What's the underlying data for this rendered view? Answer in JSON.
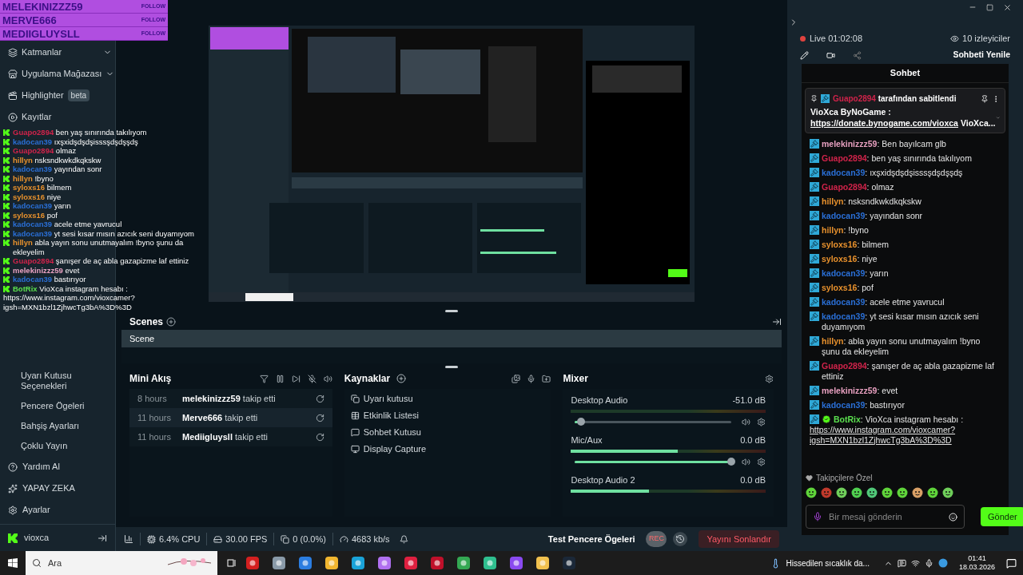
{
  "follow_alerts": [
    {
      "name": "MELEKINIZZZ59",
      "action": "FOLLOW"
    },
    {
      "name": "MERVE666",
      "action": "FOLLOW"
    },
    {
      "name": "MEDIIGLUYSLL",
      "action": "FOLLOW"
    }
  ],
  "sidebar": {
    "items": [
      {
        "label": "Katmanlar",
        "expandable": true
      },
      {
        "label": "Uygulama Mağazası",
        "expandable": true
      },
      {
        "label": "Highlighter",
        "expandable": false,
        "badge": "beta"
      },
      {
        "label": "Kayıtlar",
        "expandable": false
      }
    ],
    "sub_items": [
      "Uyarı Kutusu Seçenekleri",
      "Pencere Ögeleri",
      "Bahşiş Ayarları",
      "Çoklu Yayın"
    ],
    "bottom_items": [
      "Yardım Al",
      "YAPAY ZEKA",
      "Ayarlar"
    ],
    "user": "vioxca"
  },
  "overlay_chat": [
    {
      "user": "Guapo2894",
      "color": "#d0234a",
      "text": "ben yaş sınırında takılıyom"
    },
    {
      "user": "kadocan39",
      "color": "#2a6fd6",
      "text": "ıxşxidşdşdşisssşdşdşşdş"
    },
    {
      "user": "Guapo2894",
      "color": "#d0234a",
      "text": "olmaz"
    },
    {
      "user": "hillyn",
      "color": "#e8912d",
      "text": "nsksndkwkdkqkskw"
    },
    {
      "user": "kadocan39",
      "color": "#2a6fd6",
      "text": "yayından sonr"
    },
    {
      "user": "hillyn",
      "color": "#e8912d",
      "text": "!byno"
    },
    {
      "user": "syloxs16",
      "color": "#e8912d",
      "text": "bilmem"
    },
    {
      "user": "syloxs16",
      "color": "#e8912d",
      "text": "niye"
    },
    {
      "user": "kadocan39",
      "color": "#2a6fd6",
      "text": "yarın"
    },
    {
      "user": "syloxs16",
      "color": "#e8912d",
      "text": "pof"
    },
    {
      "user": "kadocan39",
      "color": "#2a6fd6",
      "text": "acele etme yavrucul"
    },
    {
      "user": "kadocan39",
      "color": "#2a6fd6",
      "text": "yt sesi kısar mısın azıcık seni duyamıyom"
    },
    {
      "user": "hillyn",
      "color": "#e8912d",
      "text": "abla yayın sonu unutmayalım !byno şunu da ekleyelim"
    },
    {
      "user": "Guapo2894",
      "color": "#d0234a",
      "text": "şanışer de aç abla gazapizme laf ettiniz"
    },
    {
      "user": "melekinizzz59",
      "color": "#e8a0c0",
      "text": "evet"
    },
    {
      "user": "kadocan39",
      "color": "#2a6fd6",
      "text": "bastırıyor"
    },
    {
      "user": "BotRix",
      "color": "#5be04f",
      "text": "VioXca instagram hesabı :",
      "link_lines": [
        "https://www.instagram.com/vioxcamer?",
        "igsh=MXN1bzl1ZjhwcTg3bA%3D%3D"
      ]
    }
  ],
  "scenes": {
    "title": "Scenes",
    "items": [
      {
        "label": "Scene",
        "selected": true
      }
    ]
  },
  "mini_feed": {
    "title": "Mini Akış",
    "events": [
      {
        "time": "8 hours",
        "user": "melekinizzz59",
        "action": "takip etti"
      },
      {
        "time": "11 hours",
        "user": "Merve666",
        "action": "takip etti"
      },
      {
        "time": "11 hours",
        "user": "Mediigluysll",
        "action": "takip etti"
      }
    ]
  },
  "sources": {
    "title": "Kaynaklar",
    "items": [
      "Uyarı kutusu",
      "Etkinlik Listesi",
      "Sohbet Kutusu",
      "Display Capture"
    ]
  },
  "mixer": {
    "title": "Mixer",
    "channels": [
      {
        "name": "Desktop Audio",
        "reading": "-51.0 dB",
        "fader": {
          "level": 0.04
        }
      },
      {
        "name": "Mic/Aux",
        "reading": "0.0 dB",
        "meter": {
          "level": 0.55
        },
        "fader": {
          "level": 1
        }
      },
      {
        "name": "Desktop Audio 2",
        "reading": "0.0 dB",
        "meter": {
          "level": 0.4
        }
      }
    ]
  },
  "status_bar": {
    "stats": [
      "6.4% CPU",
      "30.00 FPS",
      "0 (0.0%)",
      "4683 kb/s"
    ],
    "test_label": "Test Pencere Ögeleri",
    "rec": "REC",
    "end_stream": "Yayını Sonlandır"
  },
  "stream_info": {
    "live": "Live 01:02:08",
    "viewers": "10 izleyiciler",
    "refresh": "Sohbeti Yenile"
  },
  "chat": {
    "title": "Sohbet",
    "separator": ":",
    "pinned": {
      "by": {
        "name": "Guapo2894",
        "color": "#d0234a"
      },
      "suffix": "tarafından sabitlendi",
      "title": "VioXca ByNoGame :",
      "link": "https://donate.bynogame.com/vioxca",
      "tail": "VioXca..."
    },
    "messages": [
      {
        "user": "melekinizzz59",
        "color": "#e8a0c0",
        "text": "Ben bayılcam glb",
        "verified": false
      },
      {
        "user": "Guapo2894",
        "color": "#d0234a",
        "text": "ben yaş sınırında takılıyom",
        "verified": false
      },
      {
        "user": "kadocan39",
        "color": "#2a6fd6",
        "text": "ıxşxidşdşdşisssşdşdşşdş",
        "verified": false
      },
      {
        "user": "Guapo2894",
        "color": "#d0234a",
        "text": "olmaz",
        "verified": false
      },
      {
        "user": "hillyn",
        "color": "#e8912d",
        "text": "nsksndkwkdkqkskw",
        "verified": false
      },
      {
        "user": "kadocan39",
        "color": "#2a6fd6",
        "text": "yayından sonr",
        "verified": false
      },
      {
        "user": "hillyn",
        "color": "#e8912d",
        "text": "!byno",
        "verified": false
      },
      {
        "user": "syloxs16",
        "color": "#e8912d",
        "text": "bilmem",
        "verified": false
      },
      {
        "user": "syloxs16",
        "color": "#e8912d",
        "text": "niye",
        "verified": false
      },
      {
        "user": "kadocan39",
        "color": "#2a6fd6",
        "text": "yarın",
        "verified": false
      },
      {
        "user": "syloxs16",
        "color": "#e8912d",
        "text": "pof",
        "verified": false
      },
      {
        "user": "kadocan39",
        "color": "#2a6fd6",
        "text": "acele etme yavrucul",
        "verified": false
      },
      {
        "user": "kadocan39",
        "color": "#2a6fd6",
        "text": "yt sesi kısar mısın azıcık seni duyamıyom",
        "verified": false
      },
      {
        "user": "hillyn",
        "color": "#e8912d",
        "text": "abla yayın sonu unutmayalım !byno şunu da ekleyelim",
        "verified": false
      },
      {
        "user": "Guapo2894",
        "color": "#d0234a",
        "text": "şanışer de aç abla gazapizme laf ettiniz",
        "verified": false
      },
      {
        "user": "melekinizzz59",
        "color": "#e8a0c0",
        "text": "evet",
        "verified": false
      },
      {
        "user": "kadocan39",
        "color": "#2a6fd6",
        "text": "bastırıyor",
        "verified": false
      },
      {
        "user": "BotRix",
        "color": "#5be04f",
        "text": "VioXca instagram hesabı :",
        "verified": true,
        "link_lines": [
          "https://www.instagram.com/vioxcamer?",
          "igsh=MXN1bzl1ZjhwcTg3bA%3D%3D"
        ]
      }
    ],
    "emotes_label": "Takipçilere Özel",
    "input_placeholder": "Bir mesaj gönderin",
    "send": "Gönder"
  },
  "taskbar": {
    "search_placeholder": "Ara",
    "weather": "Hissedilen sıcaklık da...",
    "time": "01:41",
    "date": "18.03.2026"
  }
}
